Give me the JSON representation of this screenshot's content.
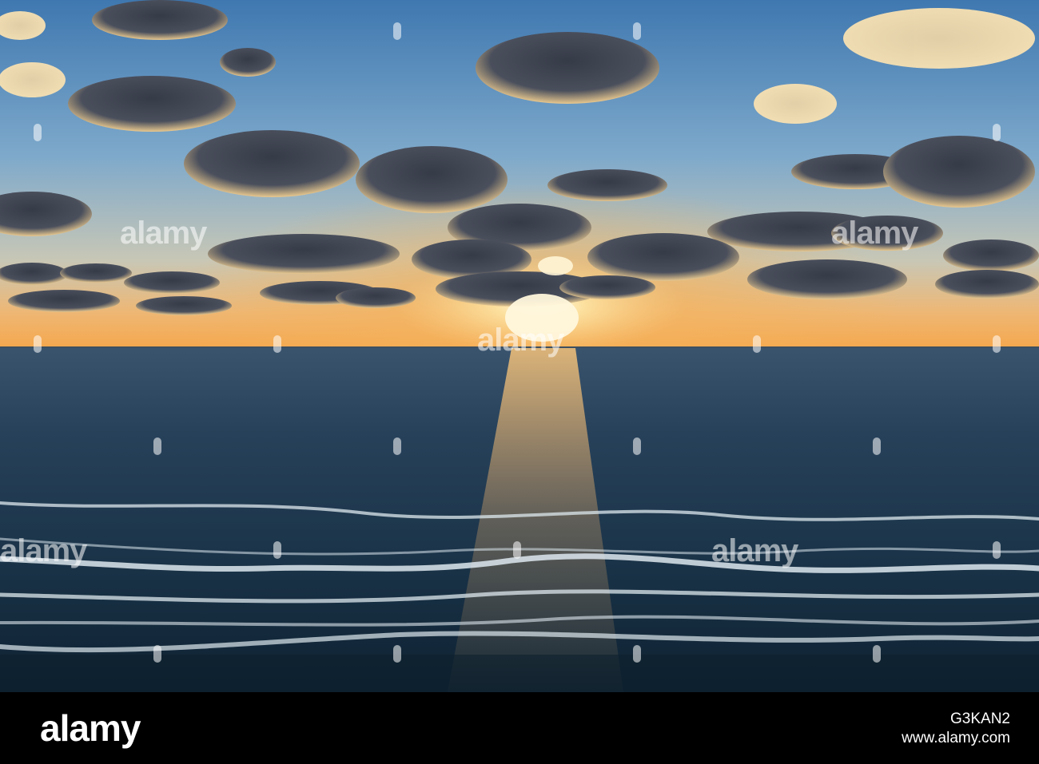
{
  "watermark": {
    "brand": "alamy"
  },
  "footer": {
    "logo": "alamy",
    "image_id": "G3KAN2",
    "site": "www.alamy.com"
  },
  "colors": {
    "sky_top": "#4a82b8",
    "sky_mid": "#8fb3cf",
    "horizon_glow": "#f3b25a",
    "sun": "#fff4cf",
    "sea_far": "#2e4a66",
    "sea_near": "#0f2538",
    "foam": "#dfe9ef",
    "cloud_dark": "#3b4150",
    "cloud_lit": "#f2d59c"
  }
}
